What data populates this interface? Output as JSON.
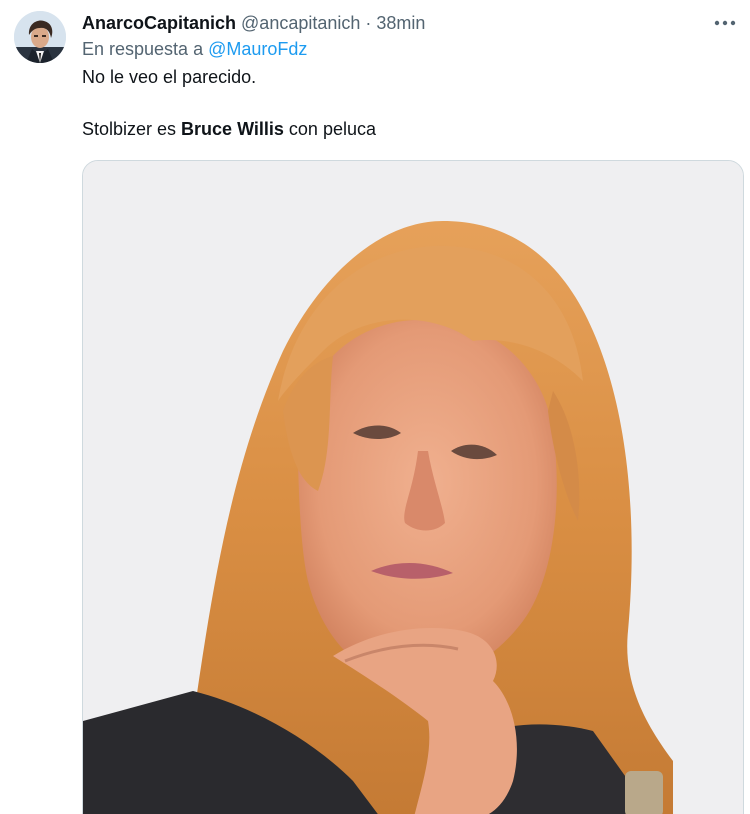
{
  "author": {
    "display_name": "AnarcoCapitanich",
    "handle": "@ancapitanich",
    "separator": "·",
    "time": "38min"
  },
  "more_icon": "more-horizontal-icon",
  "reply": {
    "prefix": "En respuesta a",
    "mention": "@MauroFdz"
  },
  "body": {
    "line1": "No le veo el parecido.",
    "line2_before": "Stolbizer es ",
    "line2_bold": "Bruce Willis",
    "line2_after": " con peluca"
  },
  "colors": {
    "link": "#1d9bf0",
    "secondary_text": "#536471",
    "border": "#cfd9de"
  }
}
